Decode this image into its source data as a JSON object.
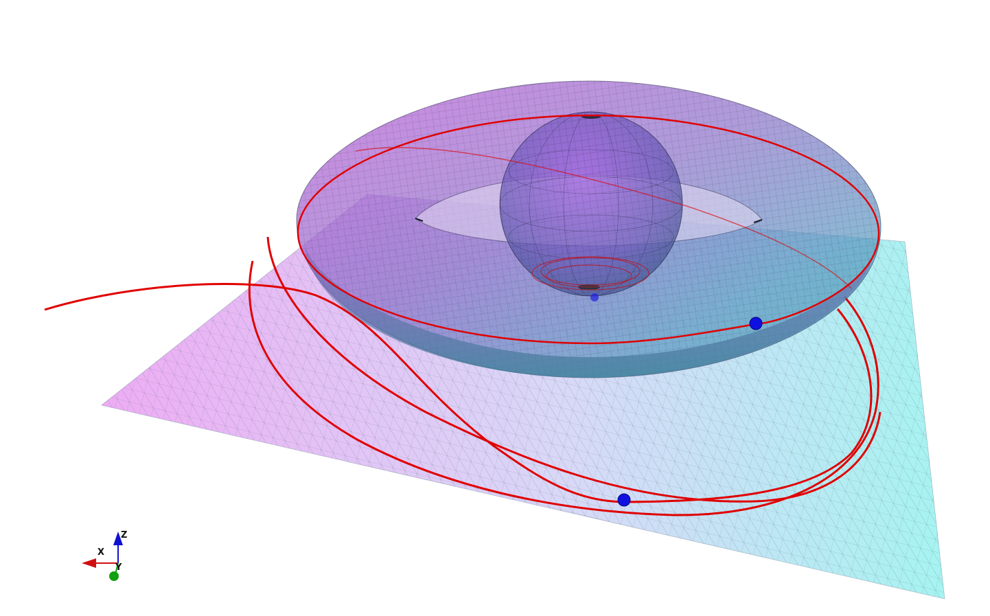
{
  "scene": {
    "background": "#ffffff",
    "plane": {
      "color_left": "#e890f0",
      "color_right": "#88f0ec",
      "mesh_color": "#4a5a6a"
    },
    "torus": {
      "color_a": "#b050c0",
      "color_b": "#5ab0c8",
      "mesh_color": "#2a2a4a"
    },
    "sphere": {
      "color_top": "#7a3ab0",
      "color_bottom": "#5a88c8",
      "mesh_color": "#2a2a4a"
    },
    "trajectory": {
      "color": "#e00000"
    },
    "bodies": {
      "color": "#1010e0",
      "count": 3
    }
  },
  "axes_triad": {
    "x": {
      "label": "X",
      "color": "#d01010"
    },
    "y": {
      "label": "Y",
      "color": "#10a010"
    },
    "z": {
      "label": "Z",
      "color": "#1010d0"
    }
  }
}
